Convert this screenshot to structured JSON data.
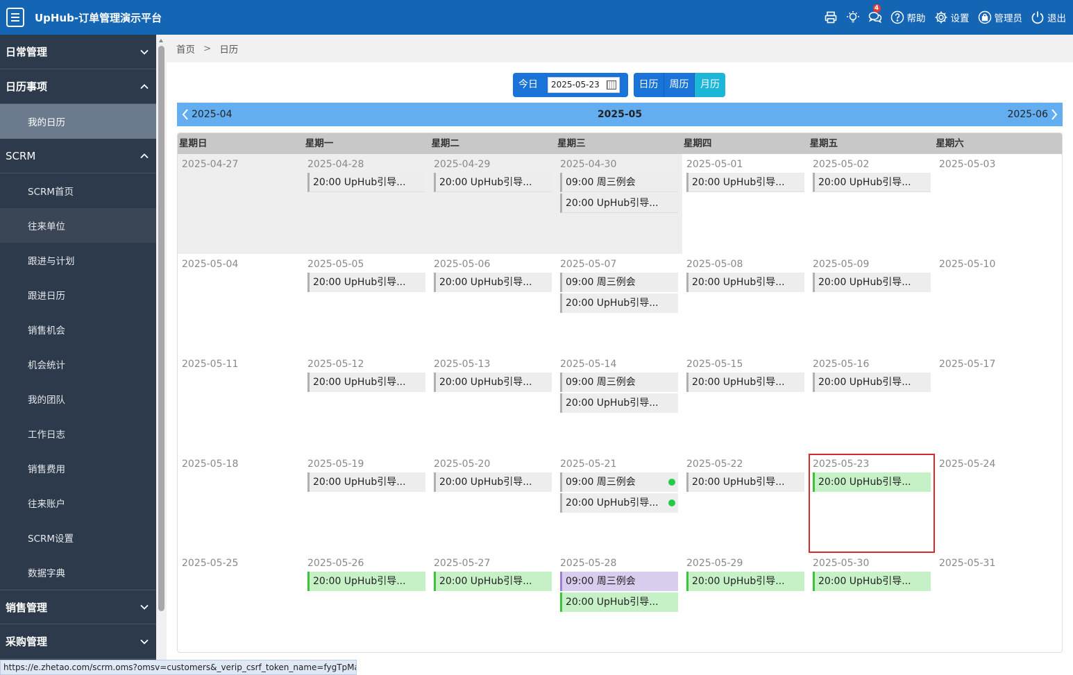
{
  "app": {
    "title": "UpHub-订单管理演示平台"
  },
  "header": {
    "print": "print-icon",
    "tips": "lightbulb-icon",
    "msg_badge": "4",
    "help": "帮助",
    "settings": "设置",
    "admin": "管理员",
    "logout": "退出"
  },
  "sidebar": {
    "groups": [
      {
        "label": "日常管理"
      },
      {
        "label": "日历事项"
      },
      {
        "label": "SCRM"
      },
      {
        "label": "销售管理"
      },
      {
        "label": "采购管理"
      }
    ],
    "calendar_items": [
      {
        "label": "我的日历"
      }
    ],
    "scrm_items": [
      {
        "label": "SCRM首页"
      },
      {
        "label": "往来单位"
      },
      {
        "label": "跟进与计划"
      },
      {
        "label": "跟进日历"
      },
      {
        "label": "销售机会"
      },
      {
        "label": "机会统计"
      },
      {
        "label": "我的团队"
      },
      {
        "label": "工作日志"
      },
      {
        "label": "销售费用"
      },
      {
        "label": "往来账户"
      },
      {
        "label": "SCRM设置"
      },
      {
        "label": "数据字典"
      }
    ]
  },
  "breadcrumb": {
    "home": "首页",
    "sep": ">",
    "current": "日历"
  },
  "toolbar": {
    "today": "今日",
    "date": "2025-05-23",
    "views": [
      "日历",
      "周历",
      "月历"
    ]
  },
  "month_nav": {
    "prev": "2025-04",
    "current": "2025-05",
    "next": "2025-06"
  },
  "weekdays": [
    "星期日",
    "星期一",
    "星期二",
    "星期三",
    "星期四",
    "星期五",
    "星期六"
  ],
  "weeks": [
    [
      {
        "date": "2025-04-27",
        "other": true,
        "events": []
      },
      {
        "date": "2025-04-28",
        "other": true,
        "events": [
          {
            "text": "20:00 UpHub引导..."
          }
        ]
      },
      {
        "date": "2025-04-29",
        "other": true,
        "events": [
          {
            "text": "20:00 UpHub引导..."
          }
        ]
      },
      {
        "date": "2025-04-30",
        "other": true,
        "events": [
          {
            "text": "09:00 周三例会"
          },
          {
            "text": "20:00 UpHub引导..."
          }
        ]
      },
      {
        "date": "2025-05-01",
        "events": [
          {
            "text": "20:00 UpHub引导..."
          }
        ]
      },
      {
        "date": "2025-05-02",
        "events": [
          {
            "text": "20:00 UpHub引导..."
          }
        ]
      },
      {
        "date": "2025-05-03",
        "events": []
      }
    ],
    [
      {
        "date": "2025-05-04",
        "events": []
      },
      {
        "date": "2025-05-05",
        "events": [
          {
            "text": "20:00 UpHub引导..."
          }
        ]
      },
      {
        "date": "2025-05-06",
        "events": [
          {
            "text": "20:00 UpHub引导..."
          }
        ]
      },
      {
        "date": "2025-05-07",
        "events": [
          {
            "text": "09:00 周三例会"
          },
          {
            "text": "20:00 UpHub引导..."
          }
        ]
      },
      {
        "date": "2025-05-08",
        "events": [
          {
            "text": "20:00 UpHub引导..."
          }
        ]
      },
      {
        "date": "2025-05-09",
        "events": [
          {
            "text": "20:00 UpHub引导..."
          }
        ]
      },
      {
        "date": "2025-05-10",
        "events": []
      }
    ],
    [
      {
        "date": "2025-05-11",
        "events": []
      },
      {
        "date": "2025-05-12",
        "events": [
          {
            "text": "20:00 UpHub引导..."
          }
        ]
      },
      {
        "date": "2025-05-13",
        "events": [
          {
            "text": "20:00 UpHub引导..."
          }
        ]
      },
      {
        "date": "2025-05-14",
        "events": [
          {
            "text": "09:00 周三例会"
          },
          {
            "text": "20:00 UpHub引导..."
          }
        ]
      },
      {
        "date": "2025-05-15",
        "events": [
          {
            "text": "20:00 UpHub引导..."
          }
        ]
      },
      {
        "date": "2025-05-16",
        "events": [
          {
            "text": "20:00 UpHub引导..."
          }
        ]
      },
      {
        "date": "2025-05-17",
        "events": []
      }
    ],
    [
      {
        "date": "2025-05-18",
        "events": []
      },
      {
        "date": "2025-05-19",
        "events": [
          {
            "text": "20:00 UpHub引导..."
          }
        ]
      },
      {
        "date": "2025-05-20",
        "events": [
          {
            "text": "20:00 UpHub引导..."
          }
        ]
      },
      {
        "date": "2025-05-21",
        "events": [
          {
            "text": "09:00 周三例会",
            "dot": true
          },
          {
            "text": "20:00 UpHub引导...",
            "dot": true
          }
        ]
      },
      {
        "date": "2025-05-22",
        "events": [
          {
            "text": "20:00 UpHub引导..."
          }
        ]
      },
      {
        "date": "2025-05-23",
        "today": true,
        "events": [
          {
            "text": "20:00 UpHub引导...",
            "color": "green"
          }
        ]
      },
      {
        "date": "2025-05-24",
        "events": []
      }
    ],
    [
      {
        "date": "2025-05-25",
        "events": []
      },
      {
        "date": "2025-05-26",
        "events": [
          {
            "text": "20:00 UpHub引导...",
            "color": "green"
          }
        ]
      },
      {
        "date": "2025-05-27",
        "events": [
          {
            "text": "20:00 UpHub引导...",
            "color": "green"
          }
        ]
      },
      {
        "date": "2025-05-28",
        "events": [
          {
            "text": "09:00 周三例会",
            "color": "purple"
          },
          {
            "text": "20:00 UpHub引导...",
            "color": "green"
          }
        ]
      },
      {
        "date": "2025-05-29",
        "events": [
          {
            "text": "20:00 UpHub引导...",
            "color": "green"
          }
        ]
      },
      {
        "date": "2025-05-30",
        "events": [
          {
            "text": "20:00 UpHub引导...",
            "color": "green"
          }
        ]
      },
      {
        "date": "2025-05-31",
        "events": []
      }
    ]
  ],
  "colors": {
    "header_bg": "#1565b5",
    "sidebar_bg": "#2d3a4b",
    "nav_bar": "#62aef0",
    "today_border": "#d9272e",
    "event_green": "#c6f0c6",
    "event_purple": "#d9cdee",
    "status_dot": "#22cc44"
  },
  "statusbar": {
    "url": "https://e.zhetao.com/scrm.oms?omsv=customers&_verip_csrf_token_name=fygTpMa..."
  }
}
